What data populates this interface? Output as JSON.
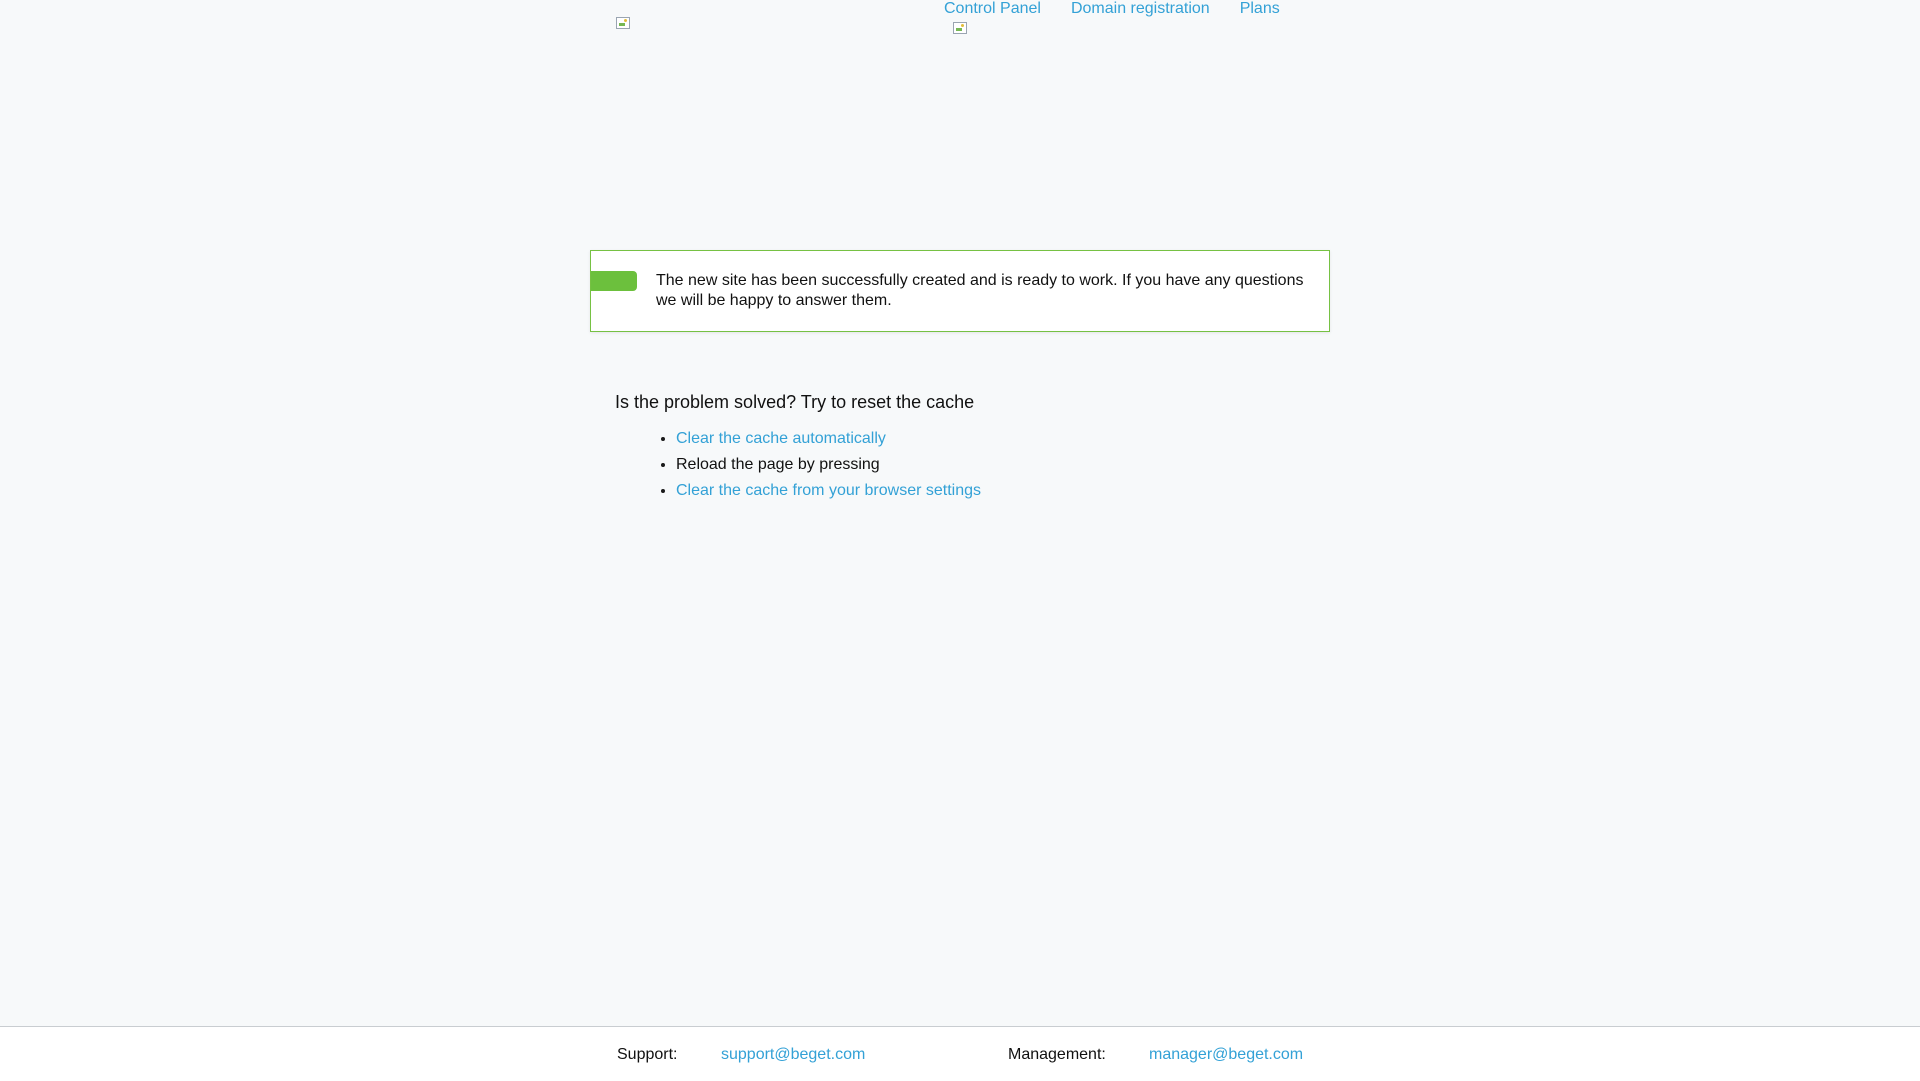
{
  "header": {
    "nav": {
      "control_panel": "Control Panel",
      "domain_registration": "Domain registration",
      "plans": "Plans"
    }
  },
  "notice": {
    "text": "The new site has been successfully created and is ready to work. If you have any questions we will be happy to answer them."
  },
  "cache": {
    "title": "Is the problem solved? Try to reset the cache",
    "items": [
      "Clear the cache automatically",
      "Reload the page by pressing",
      "Clear the cache from your browser settings"
    ]
  },
  "footer": {
    "support_label": "Support:",
    "support_email": "support@beget.com",
    "management_label": "Management:",
    "management_email": "manager@beget.com"
  },
  "colors": {
    "link": "#33a1d6",
    "accent_green": "#6cc03d",
    "background": "#f7f9fa"
  }
}
